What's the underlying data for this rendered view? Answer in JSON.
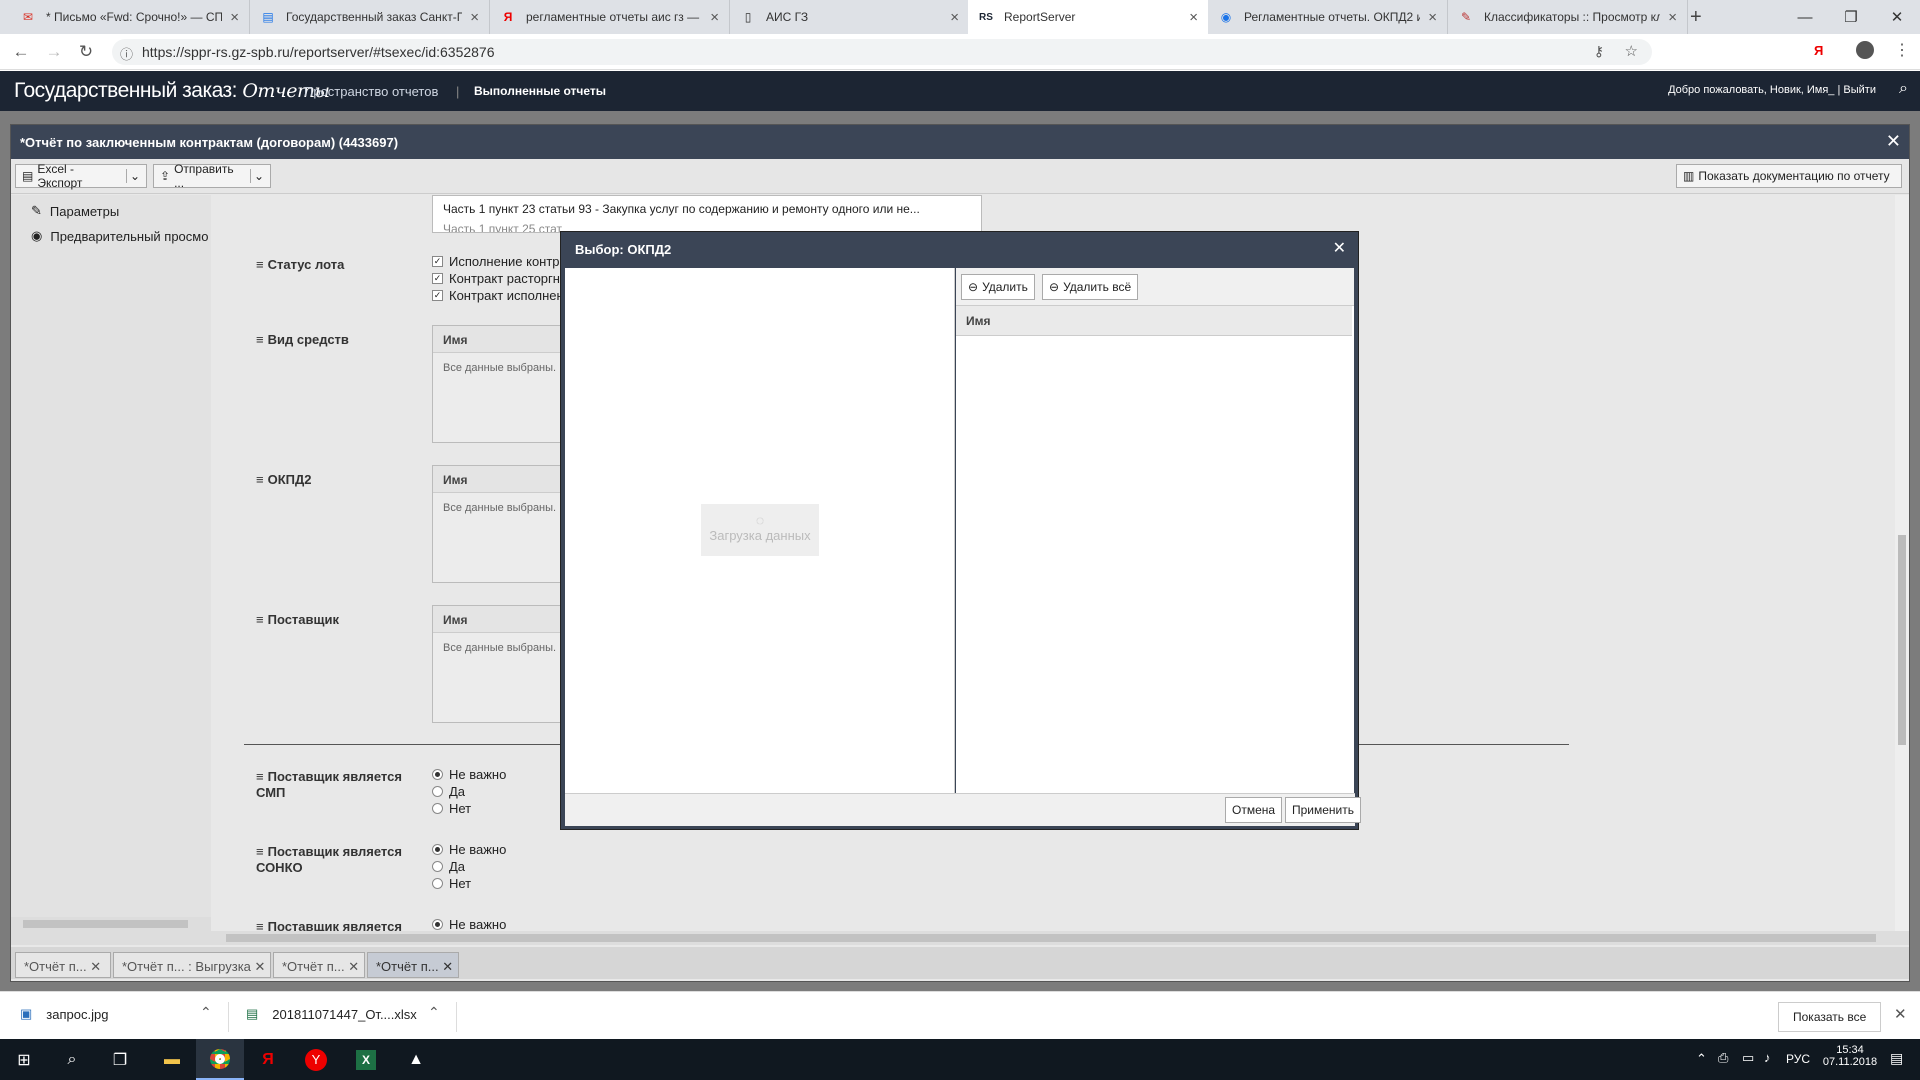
{
  "browser": {
    "tabs": [
      {
        "title": "* Письмо «Fwd: Срочно!» — СП",
        "icon": "mail-icon"
      },
      {
        "title": "Государственный заказ Санкт-П",
        "icon": "page-icon"
      },
      {
        "title": "регламентные отчеты аис гз —",
        "icon": "yandex-icon"
      },
      {
        "title": "АИС ГЗ",
        "icon": "document-icon"
      },
      {
        "title": "ReportServer",
        "icon": "reportserver-icon"
      },
      {
        "title": "Регламентные отчеты. ОКПД2 и",
        "icon": "globe-icon"
      },
      {
        "title": "Классификаторы :: Просмотр кл",
        "icon": "tools-icon"
      }
    ],
    "url": "https://sppr-rs.gz-spb.ru/reportserver/#tsexec/id:6352876",
    "yandex_label": "Я"
  },
  "app": {
    "brand": "Государственный заказ:",
    "brand_script": "Отчеты",
    "nav": [
      "Пространство отчетов",
      "Выполненные отчеты"
    ],
    "nav_separator": "|",
    "welcome": "Добро пожаловать, Новик, Имя_",
    "logout": "Выйти"
  },
  "report": {
    "title": "*Отчёт по заключенным контрактам (договорам) (4433697)",
    "export_label": "Excel - Экспорт",
    "send_label": "Отправить ...",
    "show_docs": "Показать документацию по отчету",
    "sidebar": [
      "Параметры",
      "Предварительный просмо"
    ],
    "top_list": [
      "Часть 1 пункт 23 статьи 93 - Закупка услуг по содержанию и ремонту одного или не...",
      "Часть 1 пункт 25 стат..."
    ],
    "params": {
      "status_lot": {
        "label": "Статус лота",
        "options": [
          "Исполнение контра",
          "Контракт расторгну",
          "Контракт исполнен"
        ]
      },
      "vid_sredstv": {
        "label": "Вид средств"
      },
      "okpd2": {
        "label": "ОКПД2"
      },
      "postavshik": {
        "label": "Поставщик"
      },
      "grid_header": "Имя",
      "grid_all_selected": "Все данные выбраны. Н",
      "smp": {
        "label": "Поставщик является СМП",
        "options": [
          "Не важно",
          "Да",
          "Нет"
        ]
      },
      "sonko": {
        "label": "Поставщик является СОНКО",
        "options": [
          "Не важно",
          "Да",
          "Нет"
        ]
      },
      "next": {
        "label": "Поставщик является",
        "option": "Не важно"
      }
    },
    "bottom_tabs": [
      "*Отчёт п...",
      "*Отчёт п... : Выгрузка",
      "*Отчёт п...",
      "*Отчёт п..."
    ]
  },
  "dialog": {
    "title": "Выбор: ОКПД2",
    "remove": "Удалить",
    "remove_all": "Удалить всё",
    "column_name": "Имя",
    "loading": "Загрузка данных",
    "cancel": "Отмена",
    "apply": "Применить"
  },
  "downloads": {
    "items": [
      {
        "name": "запрос.jpg"
      },
      {
        "name": "201811071447_От....xlsx"
      }
    ],
    "show_all": "Показать все"
  },
  "taskbar": {
    "lang": "РУС",
    "time": "15:34",
    "date": "07.11.2018"
  }
}
